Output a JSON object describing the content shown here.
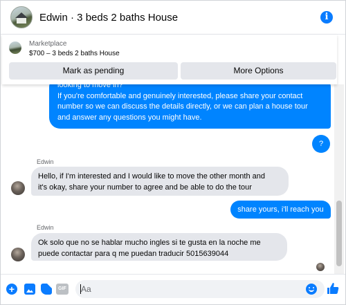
{
  "header": {
    "title": "Edwin · 3 beds 2 baths House",
    "avatar_icon": "house-avatar",
    "info_icon": "info-icon"
  },
  "marketplace": {
    "label": "Marketplace",
    "item": "$700 – 3 beds 2 baths House",
    "mark_pending_label": "Mark as pending",
    "more_options_label": "More Options"
  },
  "messages": {
    "outgoing_1": [
      "looking to move in?",
      "If you're comfortable and genuinely interested, please share your contact",
      "number so we can discuss the details directly, or we can plan a house tour",
      "and answer any questions you might have."
    ],
    "outgoing_2": "?",
    "sender_1": "Edwin",
    "incoming_1": [
      "Hello, if I'm interested and I would like to move the other month and",
      "it's okay, share your number to agree and be able to do the tour"
    ],
    "outgoing_3": "share yours, i'll reach you",
    "sender_2": "Edwin",
    "incoming_2": [
      "Ok solo que no se hablar mucho ingles si te gusta en la noche me",
      "puede contactar para q me puedan traducir 5015639044"
    ]
  },
  "composer": {
    "placeholder": "Aa",
    "gif_label": "GIF",
    "plus_label": "+"
  },
  "colors": {
    "accent": "#0084ff",
    "incoming_bubble": "#e4e6eb",
    "button_bg": "#e4e6eb"
  }
}
